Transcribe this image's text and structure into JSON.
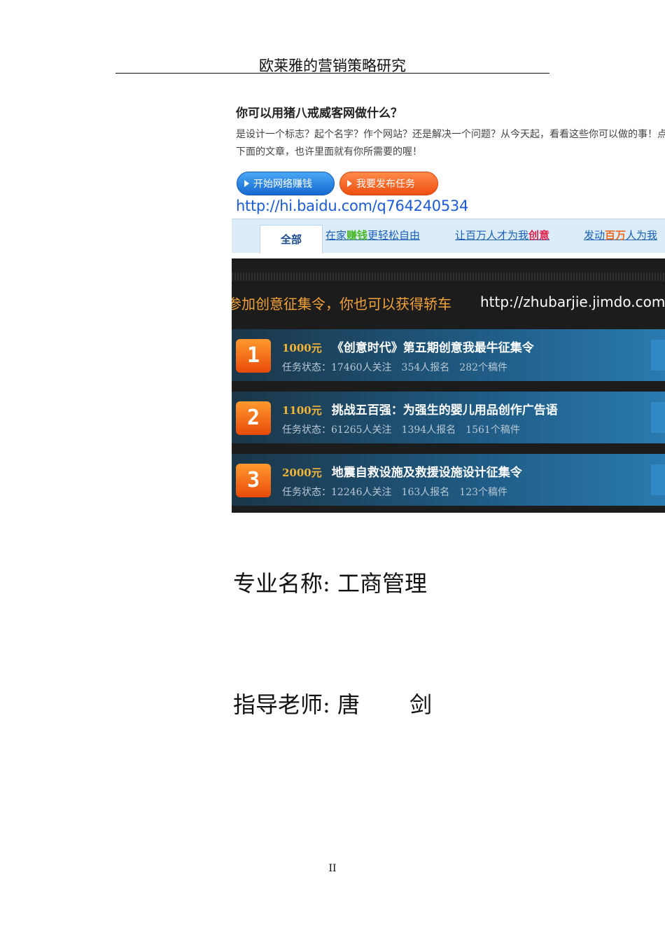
{
  "header": {
    "title": "欧莱雅的营销策略研究"
  },
  "embed": {
    "question_title": "你可以用猪八戒威客网做什么？",
    "question_desc": "是设计一个标志？起个名字？作个网站？还是解决一个问题？从今天起，看看这些你可以做的事！点击下面的文章，也许里面就有你所需要的喔！",
    "buttons": {
      "earn": "开始网络赚钱",
      "post": "我要发布任务"
    },
    "blog_url": "http://hi.baidu.com/q764240534",
    "tabs": {
      "all": "全部",
      "home_a": "在家",
      "home_hl": "赚钱",
      "home_b": "更轻松自由",
      "million_a": "让百万人才为我",
      "million_hl": "创意",
      "mobilize_a": "发动",
      "mobilize_hl": "百万",
      "mobilize_b": "人为我"
    },
    "banner": {
      "headline": "参加创意征集令，你也可以获得轿车",
      "url": "http://zhubarjie.jimdo.com/"
    },
    "tasks": [
      {
        "rank": "1",
        "reward": "1000元",
        "title": "《创意时代》第五期创意我最牛征集令",
        "status_label": "任务状态：",
        "followers": "17460人关注",
        "signups": "354人报名",
        "drafts": "282个稿件"
      },
      {
        "rank": "2",
        "reward": "1100元",
        "title": "挑战五百强：为强生的婴儿用品创作广告语",
        "status_label": "任务状态：",
        "followers": "61265人关注",
        "signups": "1394人报名",
        "drafts": "1561个稿件"
      },
      {
        "rank": "3",
        "reward": "2000元",
        "title": "地震自救设施及救援设施设计征集令",
        "status_label": "任务状态：",
        "followers": "12246人关注",
        "signups": "163人报名",
        "drafts": "123个稿件"
      }
    ]
  },
  "fields": {
    "major": "专业名称: 工商管理",
    "advisor": "指导老师: 唐       剑"
  },
  "page_number": "II"
}
